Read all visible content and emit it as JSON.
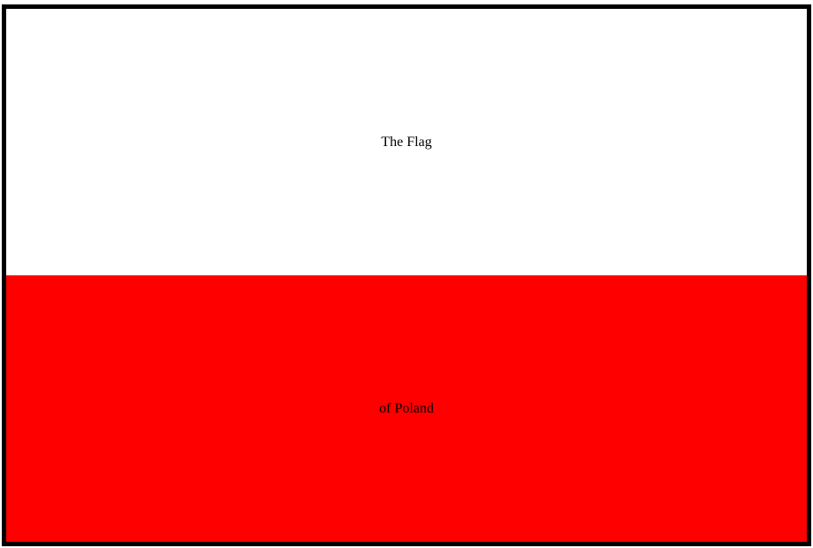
{
  "flag": {
    "top_text": "The Flag",
    "bottom_text": "of Poland",
    "colors": {
      "top_band": "#ffffff",
      "bottom_band": "#ff0000",
      "border": "#000000",
      "text": "#000000"
    }
  }
}
